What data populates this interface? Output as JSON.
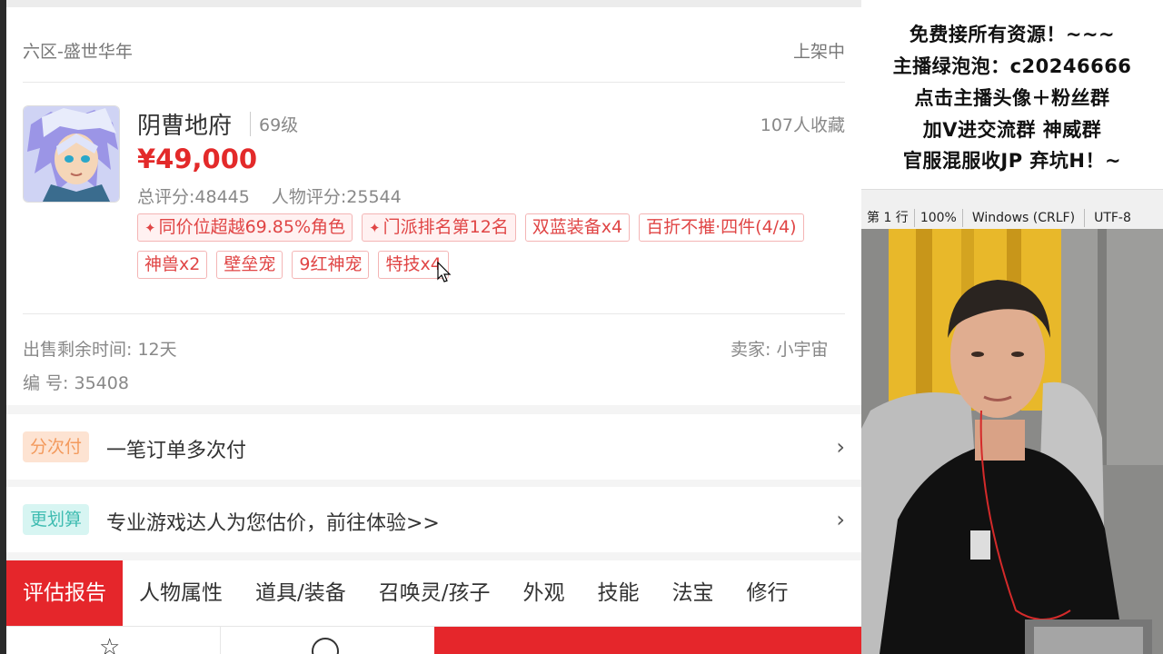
{
  "listing": {
    "server": "六区-盛世华年",
    "status": "上架中",
    "character_name": "阴曹地府",
    "level": "69级",
    "favorites": "107人收藏",
    "price": "¥49,000",
    "total_score": "总评分:48445",
    "char_score": "人物评分:25544",
    "tags": [
      {
        "text": "同价位超越69.85%角色",
        "highlight": true
      },
      {
        "text": "门派排名第12名",
        "highlight": true
      },
      {
        "text": "双蓝装备x4",
        "highlight": false
      },
      {
        "text": "百折不摧·四件(4/4)",
        "highlight": false
      },
      {
        "text": "神兽x2",
        "highlight": false
      },
      {
        "text": "壁垒宠",
        "highlight": false
      },
      {
        "text": "9红神宠",
        "highlight": false
      },
      {
        "text": "特技x4",
        "highlight": false
      }
    ],
    "remaining_time": "出售剩余时间: 12天",
    "seller": "卖家: 小宇宙",
    "serial": "编 号: 35408"
  },
  "promos": [
    {
      "badge": "分次付",
      "text": "一笔订单多次付",
      "badge_color": "#f39a5d"
    },
    {
      "badge": "更划算",
      "text": "专业游戏达人为您估价，前往体验>>",
      "badge_color": "#3fbcb1"
    }
  ],
  "tabs": [
    "评估报告",
    "人物属性",
    "道具/装备",
    "召唤灵/孩子",
    "外观",
    "技能",
    "法宝",
    "修行"
  ],
  "active_tab": 0,
  "overlay": {
    "lines": [
      "免费接所有资源！~~~",
      "主播绿泡泡：c20246666",
      "点击主播头像＋粉丝群",
      "加V进交流群 神威群",
      "官服混服收JP    弃坑H！~"
    ]
  },
  "notepad_status": {
    "position": "第 1 行",
    "zoom": "100%",
    "line_ending": "Windows (CRLF)",
    "encoding": "UTF-8"
  },
  "colors": {
    "accent_red": "#e5262b",
    "price_red": "#e32a2a",
    "tag_border": "#f4b5b5"
  },
  "icons": {
    "favorite": "star-icon",
    "service": "user-icon",
    "tag_prefix": "diamond-star-icon",
    "chevron": "chevron-right-icon"
  }
}
